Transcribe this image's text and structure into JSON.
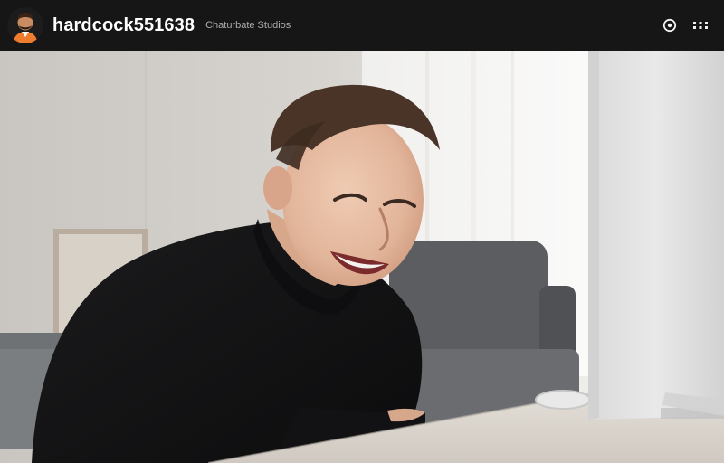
{
  "header": {
    "username": "hardcock551638",
    "subtitle": "Chaturbate Studios"
  },
  "icons": {
    "avatar": "avatar-illustration",
    "camera": "camera-icon",
    "more": "more-dots-icon"
  },
  "colors": {
    "topbar_bg": "#161616",
    "username_text": "#ffffff",
    "subtitle_text": "#bdbdbd"
  }
}
